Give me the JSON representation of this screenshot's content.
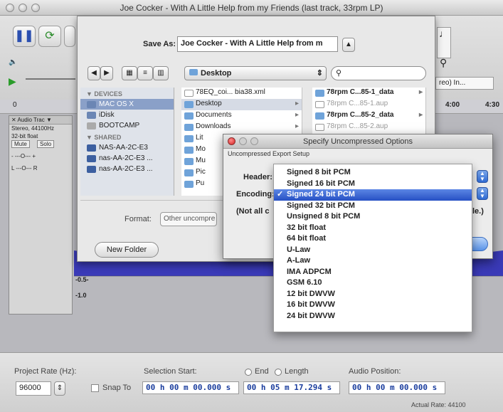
{
  "window": {
    "title": "Joe Cocker - With A Little Help from my Friends (last track, 33rpm LP)"
  },
  "tracks": {
    "track_name": "Audio Trac",
    "info_line1": "Stereo, 44100Hz",
    "info_line2": "32-bit float",
    "mute_label": "Mute",
    "solo_label": "Solo",
    "scale_neg05": "-0.5-",
    "scale_neg10": "-1.0",
    "ruler_400": "4:00",
    "ruler_430": "4:30",
    "device_partial": "reo) In..."
  },
  "save_sheet": {
    "save_as_label": "Save As:",
    "filename": "Joe Cocker - With A Little Help from m",
    "location": "Desktop",
    "search_placeholder": "",
    "sidebar": {
      "devices_heading": "DEVICES",
      "devices": [
        "MAC OS X",
        "iDisk",
        "BOOTCAMP"
      ],
      "shared_heading": "SHARED",
      "shared": [
        "NAS-AA-2C-E3",
        "nas-AA-2C-E3 ...",
        "nas-AA-2C-E3 ..."
      ]
    },
    "column1": [
      "78EQ_coi... bia38.xml",
      "Desktop",
      "Documents",
      "Downloads",
      "Lit",
      "Mo",
      "Mu",
      "Pic",
      "Pu"
    ],
    "column2": [
      "78rpm C...85-1_data",
      "78rpm C...85-1.aup",
      "78rpm C...85-2_data",
      "78rpm C...85-2.aup"
    ],
    "format_label": "Format:",
    "format_value": "Other uncompre",
    "new_folder_label": "New Folder"
  },
  "dialog": {
    "title": "Specify Uncompressed Options",
    "subtitle": "Uncompressed Export Setup",
    "header_label": "Header:",
    "encoding_label": "Encoding:",
    "note_partial": "(Not all c",
    "note_tail": "le.)"
  },
  "encoding_dropdown": {
    "selected_index": 2,
    "options": [
      "Signed 8 bit PCM",
      "Signed 16 bit PCM",
      "Signed 24 bit PCM",
      "Signed 32 bit PCM",
      "Unsigned 8 bit PCM",
      "32 bit float",
      "64 bit float",
      "U-Law",
      "A-Law",
      "IMA ADPCM",
      "GSM 6.10",
      "12 bit DWVW",
      "16 bit DWVW",
      "24 bit DWVW"
    ]
  },
  "bottom": {
    "project_rate_label": "Project Rate (Hz):",
    "project_rate_value": "96000",
    "snap_to_label": "Snap To",
    "selection_start_label": "Selection Start:",
    "end_label": "End",
    "length_label": "Length",
    "audio_position_label": "Audio Position:",
    "selection_start": "00 h 00 m 00.000 s",
    "selection_end": "00 h 05 m 17.294 s",
    "audio_position": "00 h 00 m 00.000 s",
    "actual_rate": "Actual Rate: 44100"
  }
}
